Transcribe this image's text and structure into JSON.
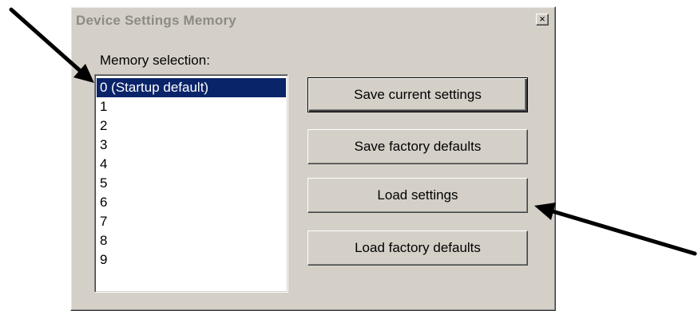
{
  "dialog": {
    "title": "Device Settings Memory",
    "close_label": "×",
    "memory_label": "Memory selection:",
    "memory_items": [
      "0 (Startup default)",
      "1",
      "2",
      "3",
      "4",
      "5",
      "6",
      "7",
      "8",
      "9"
    ],
    "selected_index": 0,
    "buttons": {
      "save_current": "Save current settings",
      "save_factory": "Save factory defaults",
      "load_settings": "Load settings",
      "load_factory": "Load factory defaults"
    }
  },
  "annotations": {
    "arrows": [
      "arrow-to-startup-default",
      "arrow-to-load-settings"
    ]
  },
  "colors": {
    "dialog_face": "#d4d0c8",
    "selection": "#0a246a",
    "title_text": "#8c8a84",
    "arrow": "#000000"
  }
}
